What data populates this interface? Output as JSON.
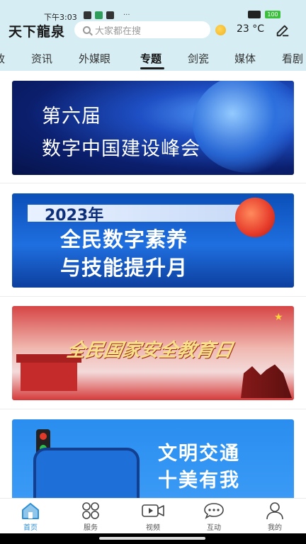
{
  "status": {
    "time": "下午3:03",
    "more": "···",
    "battery": "100"
  },
  "header": {
    "logo": "天下龍泉",
    "search_placeholder": "大家都在搜",
    "temperature": "23 °C",
    "icons": [
      "search-icon",
      "sun-icon",
      "edit-icon"
    ]
  },
  "tabs": [
    "政",
    "资讯",
    "外媒眼",
    "专题",
    "剑瓷",
    "媒体",
    "看剧"
  ],
  "active_tab": "专题",
  "banners": [
    {
      "lines": [
        "第六届",
        "数字中国建设峰会"
      ]
    },
    {
      "year": "2023年",
      "lines": [
        "全民数字素养",
        "与技能提升月"
      ]
    },
    {
      "lines": [
        "全民国家安全教育日"
      ]
    },
    {
      "lines": [
        "文明交通",
        "十美有我"
      ]
    }
  ],
  "bottom_nav": [
    {
      "label": "首页",
      "icon": "home-icon",
      "active": true
    },
    {
      "label": "服务",
      "icon": "grid-icon",
      "active": false
    },
    {
      "label": "视频",
      "icon": "video-icon",
      "active": false
    },
    {
      "label": "互动",
      "icon": "chat-icon",
      "active": false
    },
    {
      "label": "我的",
      "icon": "user-icon",
      "active": false
    }
  ],
  "colors": {
    "header_bg": "#d6eef3",
    "accent": "#2d8fd5"
  }
}
